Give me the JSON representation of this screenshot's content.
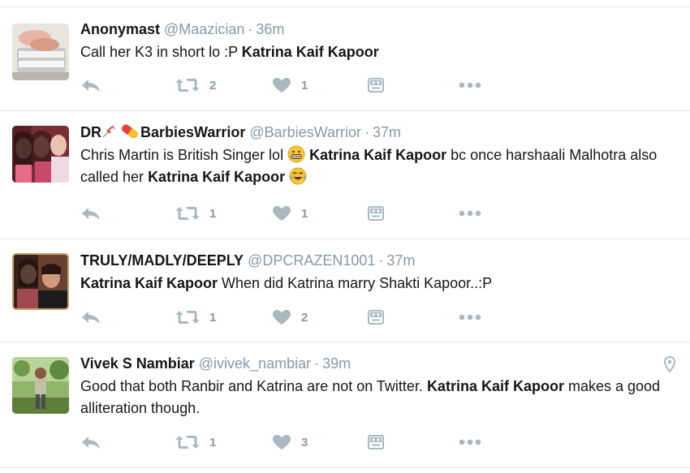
{
  "tweets": [
    {
      "name": "Anonymast",
      "handle": "@Maazician",
      "time": "36m",
      "text_html": "Call her K3 in short lo :P <b>Katrina Kaif Kapoor</b>",
      "retweets": "2",
      "likes": "1"
    },
    {
      "name": "DR",
      "name_suffix": "BarbiesWarrior",
      "handle": "@BarbiesWarrior",
      "time": "37m",
      "text_html": "Chris Martin is British Singer lol [grin-emoji] <b>Katrina Kaif Kapoor</b> bc once harshaali Malhotra also called her <b>Katrina Kaif Kapoor</b> [joy-emoji]",
      "retweets": "1",
      "likes": "1"
    },
    {
      "name": "TRULY/MADLY/DEEPLY",
      "handle": "@DPCRAZEN1001",
      "time": "37m",
      "text_html": "<b>Katrina Kaif Kapoor</b> When did Katrina marry Shakti Kapoor..:P",
      "retweets": "1",
      "likes": "2"
    },
    {
      "name": "Vivek S Nambiar",
      "handle": "@ivivek_nambiar",
      "time": "39m",
      "text_html": "Good that both Ranbir and Katrina are not on Twitter. <b>Katrina Kaif Kapoor</b> makes a good alliteration though.",
      "retweets": "1",
      "likes": "3",
      "has_location": true
    }
  ],
  "icons": {
    "reply": "reply-icon",
    "retweet": "retweet-icon",
    "like": "heart-icon",
    "dm": "direct-message-icon",
    "more": "more-icon",
    "location": "location-pin-icon"
  },
  "colors": {
    "icon": "#aab8c2",
    "muted": "#8899a6",
    "separator": "#e1e8ed"
  }
}
